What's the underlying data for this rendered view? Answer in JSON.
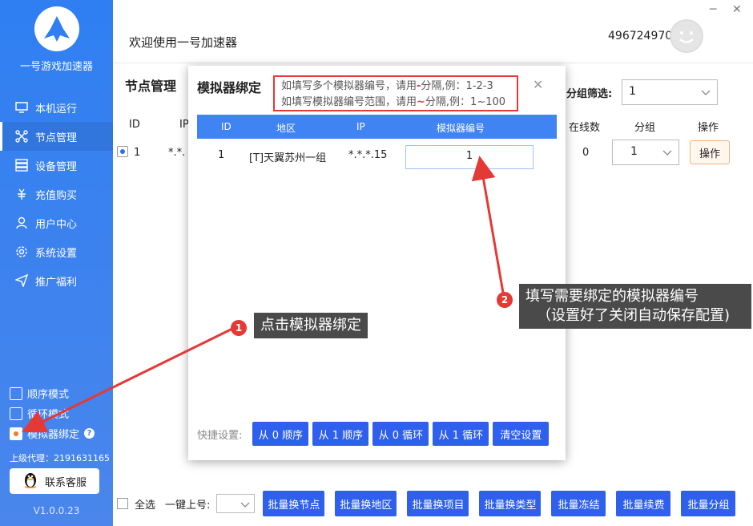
{
  "sidebar": {
    "app_name": "一号游戏加速器",
    "items": [
      {
        "label": "本机运行",
        "icon": "monitor-icon"
      },
      {
        "label": "节点管理",
        "icon": "nodes-icon"
      },
      {
        "label": "设备管理",
        "icon": "devices-icon"
      },
      {
        "label": "充值购买",
        "icon": "recharge-icon"
      },
      {
        "label": "用户中心",
        "icon": "user-icon"
      },
      {
        "label": "系统设置",
        "icon": "gear-icon"
      },
      {
        "label": "推广福利",
        "icon": "send-icon"
      }
    ],
    "active_index": 1,
    "modes": [
      {
        "label": "顺序模式",
        "checked": false
      },
      {
        "label": "循环模式",
        "checked": false
      },
      {
        "label": "模拟器绑定",
        "checked": true
      }
    ],
    "agent": "上级代理：2191631165",
    "contact_label": "联系客服",
    "version": "V1.0.0.23"
  },
  "header": {
    "welcome": "欢迎使用一号加速器",
    "user_id": "496724970",
    "minimize": "─",
    "close": "✕"
  },
  "main": {
    "title": "节点管理",
    "group_filter_label": "分组筛选:",
    "group_filter_value": "1",
    "columns": {
      "id": "ID",
      "ip": "IP",
      "online": "在线数",
      "group": "分组",
      "action": "操作"
    },
    "row": {
      "id": "1",
      "ip": "*.*.",
      "online": "0",
      "group": "1",
      "action": "操作"
    }
  },
  "bottom": {
    "select_all": "全选",
    "one_click": "一键上号:",
    "buttons": [
      "批量换节点",
      "批量换地区",
      "批量换项目",
      "批量换类型",
      "批量冻结",
      "批量续费",
      "批量分组"
    ]
  },
  "modal": {
    "title": "模拟器绑定",
    "hint1_a": "如填写多个模拟器编号，请用",
    "hint1_b": "-",
    "hint1_c": "分隔,例：1-2-3",
    "hint2_a": "如填写模拟器编号范围，请用",
    "hint2_b": "~",
    "hint2_c": "分隔,例：1~100",
    "close": "✕",
    "columns": {
      "id": "ID",
      "region": "地区",
      "ip": "IP",
      "emu": "模拟器编号"
    },
    "row": {
      "id": "1",
      "region": "[T]天翼苏州一组",
      "ip": "*.*.*.15",
      "emu": "1"
    },
    "quick_label": "快捷设置:",
    "quick_buttons": [
      "从 0 顺序",
      "从 1 顺序",
      "从 0 循环",
      "从 1 循环",
      "清空设置"
    ]
  },
  "annotations": {
    "step1_num": "1",
    "step1_text": "点击模拟器绑定",
    "step2_num": "2",
    "step2_line1": "填写需要绑定的模拟器编号",
    "step2_line2": "（设置好了关闭自动保存配置)"
  },
  "colors": {
    "sidebar": "#3f83ee",
    "accent_blue": "#2e5fed",
    "table_head": "#4083f3",
    "annotation_red": "#e53935"
  }
}
